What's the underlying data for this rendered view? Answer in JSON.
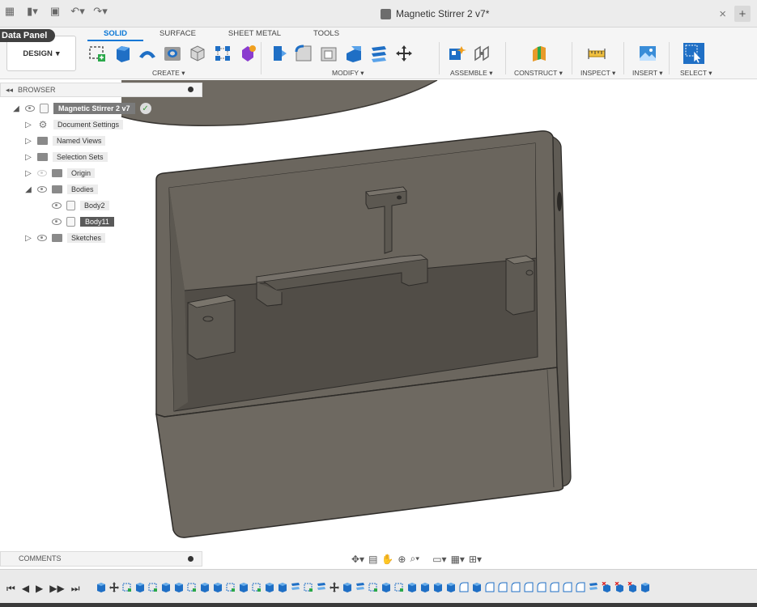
{
  "titlebar": {
    "doc_title": "Magnetic Stirrer 2 v7*",
    "icons": [
      "grid-icon",
      "file-icon",
      "save-icon",
      "undo-icon",
      "redo-icon"
    ],
    "close_label": "×",
    "new_tab_label": "+"
  },
  "data_panel_label": "Data Panel",
  "toolbar": {
    "tabs": [
      {
        "label": "SOLID",
        "active": true
      },
      {
        "label": "SURFACE",
        "active": false
      },
      {
        "label": "SHEET METAL",
        "active": false
      },
      {
        "label": "TOOLS",
        "active": false
      }
    ],
    "workspace_label": "DESIGN",
    "groups": {
      "create": "CREATE",
      "modify": "MODIFY",
      "assemble": "ASSEMBLE",
      "construct": "CONSTRUCT",
      "inspect": "INSPECT",
      "insert": "INSERT",
      "select": "SELECT"
    },
    "accent_color": "#0a77d6"
  },
  "browser": {
    "header_label": "BROWSER",
    "root_label": "Magnetic Stirrer 2 v7",
    "items": [
      {
        "label": "Document Settings"
      },
      {
        "label": "Named Views"
      },
      {
        "label": "Selection Sets"
      },
      {
        "label": "Origin"
      },
      {
        "label": "Bodies"
      },
      {
        "label": "Body2"
      },
      {
        "label": "Body11"
      },
      {
        "label": "Sketches"
      }
    ]
  },
  "comments_label": "COMMENTS",
  "model_color": "#5b5750"
}
